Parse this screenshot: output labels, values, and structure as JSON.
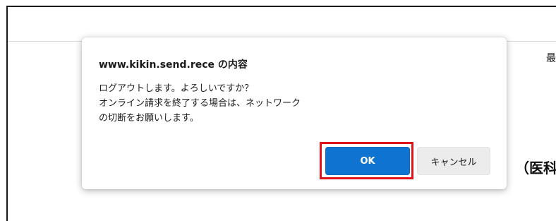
{
  "background": {
    "partial_text_top_right": "最",
    "partial_text_bottom_right": "（医科"
  },
  "dialog": {
    "title": "www.kikin.send.rece の内容",
    "message_lines": [
      "ログアウトします。よろしいですか？",
      "オンライン請求を終了する場合は、ネットワーク",
      "の切断をお願いします。"
    ],
    "ok_label": "OK",
    "cancel_label": "キャンセル"
  },
  "colors": {
    "ok_button": "#0f74d1",
    "cancel_button": "#ececec",
    "highlight": "#e2141b"
  }
}
